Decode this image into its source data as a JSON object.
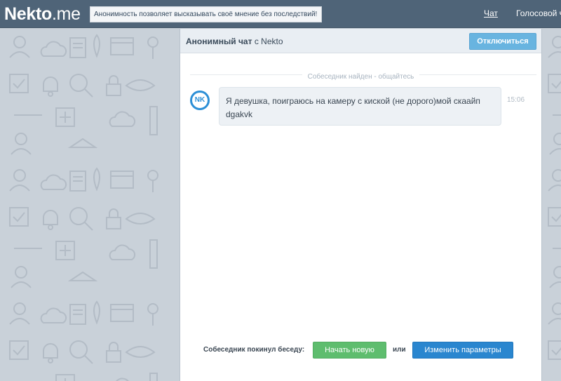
{
  "header": {
    "logo_bold": "Nekto",
    "logo_light": ".me",
    "tagline": "Анонимность позволяет высказывать своё мнение без последствий!",
    "nav_chat": "Чат",
    "nav_voice": "Голосовой чат"
  },
  "chat": {
    "title_bold": "Анонимный чат",
    "title_rest": " с Nekto",
    "disconnect_label": "Отключиться",
    "found_text": "Собеседник найден - общайтесь",
    "messages": [
      {
        "avatar": "NK",
        "text": "Я девушка, поиграюсь на камеру с киской (не дорого)мой скаайп dgakvk",
        "time": "15:06"
      }
    ]
  },
  "footer": {
    "left_label": "Собеседник покинул беседу:",
    "new_label": "Начать новую",
    "or_label": "или",
    "params_label": "Изменить параметры"
  },
  "colors": {
    "topbar": "#4f6478",
    "accent_blue": "#2a86cf",
    "accent_green": "#5ebd6e",
    "disconnect": "#68b4e0"
  }
}
